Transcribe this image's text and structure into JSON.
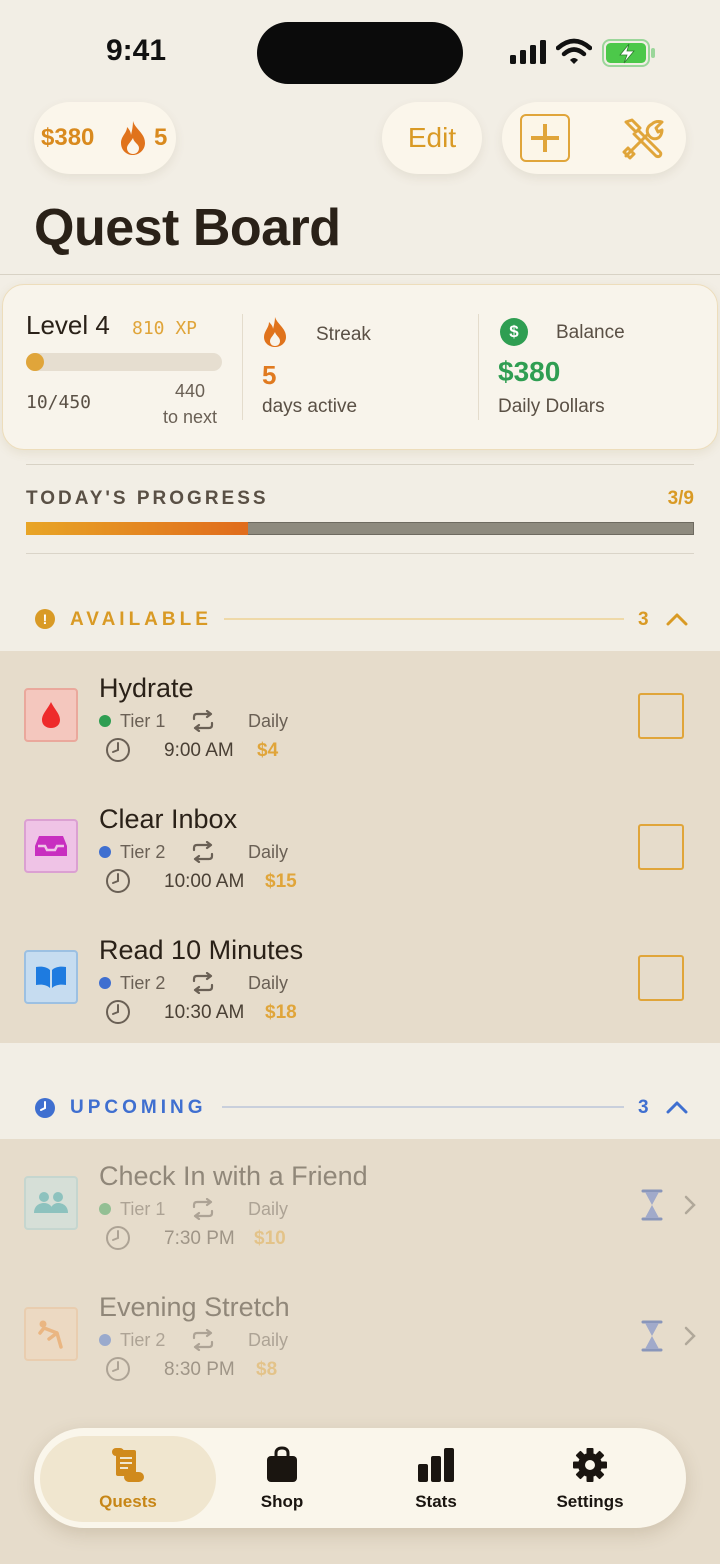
{
  "status_bar": {
    "time": "9:41"
  },
  "header": {
    "balance": "$380",
    "streak_count": "5",
    "edit_label": "Edit",
    "title": "Quest Board"
  },
  "stats": {
    "level": "Level 4",
    "xp": "810 XP",
    "level_progress_fraction": 0.022,
    "level_frac": "10/450",
    "to_next_value": "440",
    "to_next_label": "to next",
    "streak_label": "Streak",
    "streak_value": "5",
    "streak_sub": "days active",
    "balance_icon": "$",
    "balance_label": "Balance",
    "balance_value": "$380",
    "balance_sub": "Daily Dollars"
  },
  "progress": {
    "label": "TODAY'S PROGRESS",
    "count": "3/9",
    "fraction": 0.333
  },
  "sections": {
    "available": {
      "icon": "!",
      "label": "AVAILABLE",
      "count": "3",
      "color": "#D99A25",
      "items": [
        {
          "name": "Hydrate",
          "tier": "Tier 1",
          "tier_color": "#2F9E52",
          "frequency": "Daily",
          "time": "9:00 AM",
          "reward": "$4",
          "icon": "water-drop-icon"
        },
        {
          "name": "Clear Inbox",
          "tier": "Tier 2",
          "tier_color": "#3F6FD0",
          "frequency": "Daily",
          "time": "10:00 AM",
          "reward": "$15",
          "icon": "inbox-tray-icon"
        },
        {
          "name": "Read 10 Minutes",
          "tier": "Tier 2",
          "tier_color": "#3F6FD0",
          "frequency": "Daily",
          "time": "10:30 AM",
          "reward": "$18",
          "icon": "open-book-icon"
        }
      ]
    },
    "upcoming": {
      "label": "UPCOMING",
      "count": "3",
      "color": "#3F6FD0",
      "items": [
        {
          "name": "Check In with a Friend",
          "tier": "Tier 1",
          "tier_color": "#2F9E52",
          "frequency": "Daily",
          "time": "7:30 PM",
          "reward": "$10",
          "icon": "people-icon"
        },
        {
          "name": "Evening Stretch",
          "tier": "Tier 2",
          "tier_color": "#3F6FD0",
          "frequency": "Daily",
          "time": "8:30 PM",
          "reward": "$8",
          "icon": "stretch-figure-icon"
        }
      ]
    }
  },
  "tabs": [
    {
      "label": "Quests",
      "icon": "scroll-icon",
      "active": true
    },
    {
      "label": "Shop",
      "icon": "bag-icon",
      "active": false
    },
    {
      "label": "Stats",
      "icon": "bar-chart-icon",
      "active": false
    },
    {
      "label": "Settings",
      "icon": "gear-icon",
      "active": false
    }
  ]
}
